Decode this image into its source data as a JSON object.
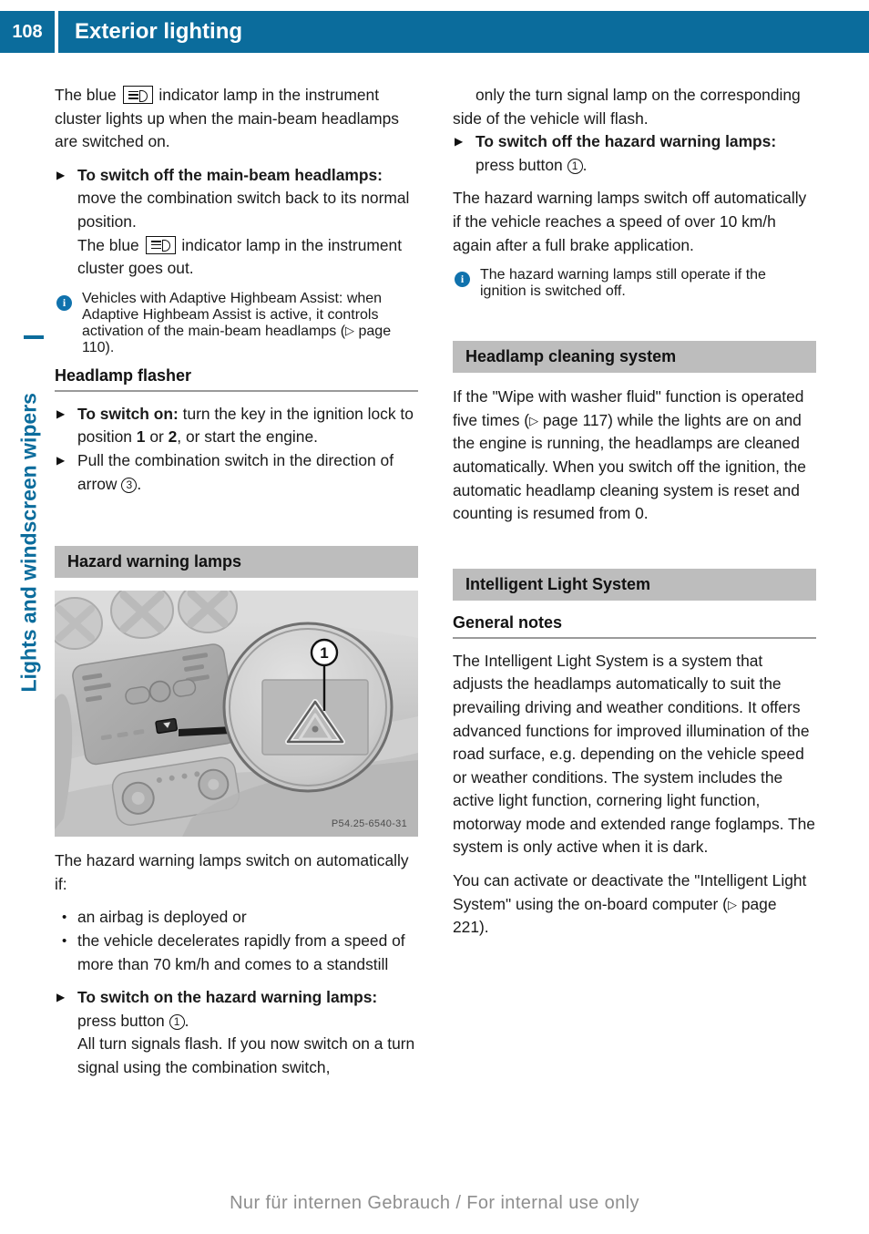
{
  "header": {
    "page_number": "108",
    "chapter_title": "Exterior lighting",
    "accent_color": "#0b6c9c"
  },
  "side_tab": {
    "label": "Lights and windscreen wipers"
  },
  "left_column": {
    "intro_para": {
      "before_symbol": "The blue",
      "symbol": "main-beam-indicator",
      "after_symbol": "indicator lamp in the instrument cluster lights up when the main-beam headlamps are switched on."
    },
    "step_switch_off_main_beam": {
      "bold": "To switch off the main-beam headlamps:",
      "rest": "move the combination switch back to its normal position."
    },
    "after_step_para": {
      "before_symbol": "The blue",
      "symbol": "main-beam-indicator",
      "after_symbol": "indicator lamp in the instrument cluster goes out."
    },
    "note_adaptive_highbeam": "Vehicles with Adaptive Highbeam Assist: when Adaptive Highbeam Assist is active, it controls activation of the main-beam headlamps (",
    "note_adaptive_highbeam_ref": "page 110",
    "note_adaptive_highbeam_end": ").",
    "headlamp_flasher": {
      "subhead": "Headlamp flasher",
      "step_switch_on_bold": "To switch on:",
      "step_switch_on_rest_a": "turn the key in the ignition lock to position",
      "step_switch_on_pos1": "1",
      "step_switch_on_or": "or",
      "step_switch_on_pos2": "2",
      "step_switch_on_rest_b": ", or start the engine.",
      "step_pull_a": "Pull the combination switch in the direction of arrow",
      "step_pull_callout": "3",
      "step_pull_b": "."
    },
    "hazard_warning_lamps": {
      "section_title": "Hazard warning lamps",
      "figure_code": "P54.25-6540-31",
      "figure_callout": "1",
      "auto_intro": "The hazard warning lamps switch on automatically if:",
      "auto_conditions": [
        "an airbag is deployed or",
        "the vehicle decelerates rapidly from a speed of more than 70 km/h and comes to a standstill"
      ],
      "step_switch_on_bold": "To switch on the hazard warning lamps:",
      "step_switch_on_rest_a": "press button",
      "step_switch_on_callout": "1",
      "step_switch_on_rest_b": ".",
      "step_switch_on_extra": "All turn signals flash. If you now switch on a turn signal using the combination switch,"
    }
  },
  "right_column": {
    "continuation": "only the turn signal lamp on the corresponding side of the vehicle will flash.",
    "step_switch_off_bold": "To switch off the hazard warning lamps:",
    "step_switch_off_rest_a": "press button",
    "step_switch_off_callout": "1",
    "step_switch_off_rest_b": ".",
    "auto_switch_off": "The hazard warning lamps switch off automatically if the vehicle reaches a speed of over 10 km/h again after a full brake application.",
    "note_ignition": "The hazard warning lamps still operate if the ignition is switched off.",
    "headlamp_cleaning": {
      "section_title": "Headlamp cleaning system",
      "body_a": "If the \"Wipe with washer fluid\" function is operated five times (",
      "body_ref": "page 117",
      "body_b": ") while the lights are on and the engine is running, the headlamps are cleaned automatically. When you switch off the ignition, the automatic headlamp cleaning system is reset and counting is resumed from 0."
    },
    "intelligent_light_system": {
      "section_title": "Intelligent Light System",
      "subhead": "General notes",
      "para1": "The Intelligent Light System is a system that adjusts the headlamps automatically to suit the prevailing driving and weather conditions. It offers advanced functions for improved illumination of the road surface, e.g. depending on the vehicle speed or weather conditions. The system includes the active light function, cornering light function, motorway mode and extended range foglamps. The system is only active when it is dark.",
      "para2_a": "You can activate or deactivate the \"Intelligent Light System\" using the on-board computer (",
      "para2_ref": "page 221",
      "para2_b": ")."
    }
  },
  "footer": {
    "text": "Nur für internen Gebrauch / For internal use only"
  }
}
